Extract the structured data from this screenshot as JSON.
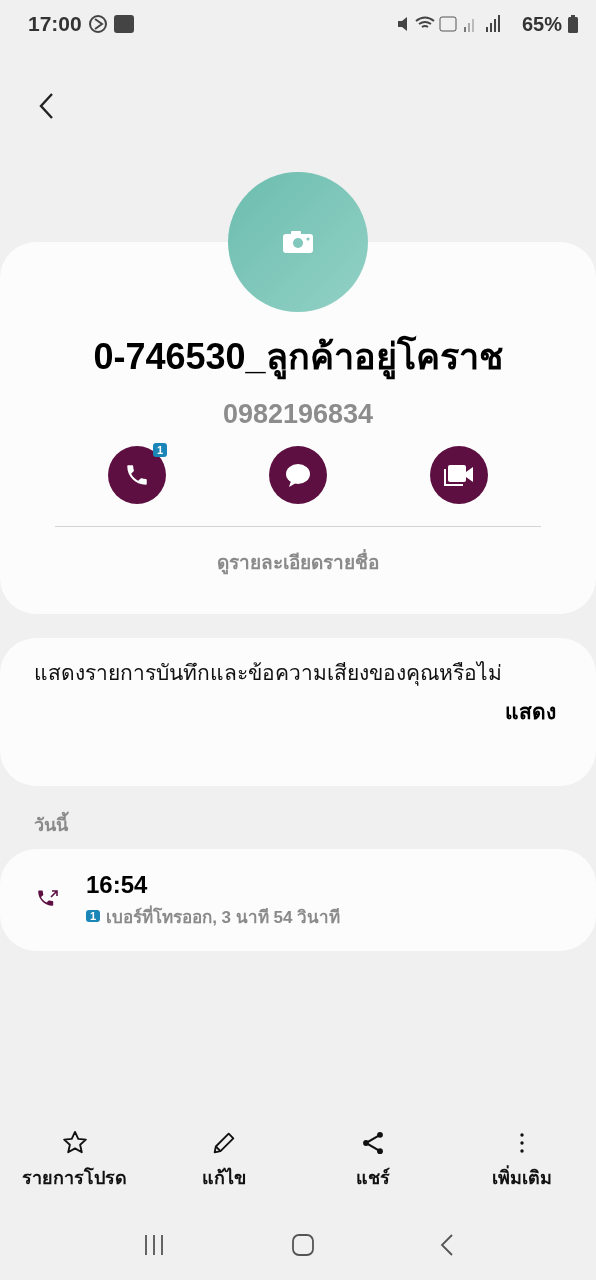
{
  "status_bar": {
    "time": "17:00",
    "battery": "65%"
  },
  "contact": {
    "name": "0-746530_ลูกค้าอยู่โคราช",
    "number": "0982196834",
    "sim_badge": "1",
    "details_link": "ดูรายละเอียดรายชื่อ"
  },
  "actions": [
    {
      "kind": "call"
    },
    {
      "kind": "message"
    },
    {
      "kind": "video"
    }
  ],
  "recording_prompt": {
    "text": "แสดงรายการบันทึกและข้อความเสียงของคุณหรือไม่",
    "button": "แสดง"
  },
  "history": {
    "section": "วันนี้",
    "entries": [
      {
        "time": "16:54",
        "sim": "1",
        "detail": "เบอร์ที่โทรออก, 3 นาที 54 วินาที"
      }
    ]
  },
  "bottom_actions": [
    {
      "kind": "star",
      "label": "รายการโปรด"
    },
    {
      "kind": "edit",
      "label": "แก้ไข"
    },
    {
      "kind": "share",
      "label": "แชร์"
    },
    {
      "kind": "more",
      "label": "เพิ่มเติม"
    }
  ]
}
